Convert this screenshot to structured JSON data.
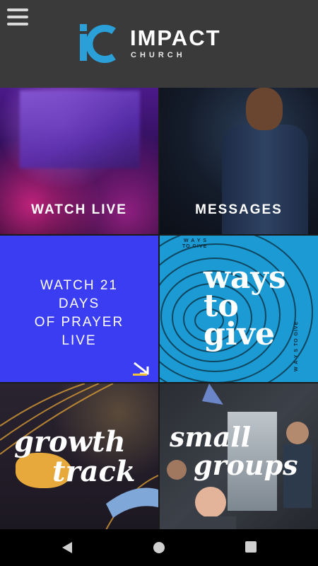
{
  "header": {
    "logo_word": "IMPACT",
    "logo_sub": "CHURCH",
    "menu_icon": "hamburger-menu-icon",
    "accent": "#2a9fd8"
  },
  "tiles": [
    {
      "label": "WATCH LIVE"
    },
    {
      "label": "MESSAGES"
    },
    {
      "label_lines": [
        "WATCH 21",
        "DAYS",
        "OF PRAYER",
        "LIVE"
      ],
      "arrow_icon": "arrow-down-right-icon",
      "arrow_color": "#f2c33a",
      "bg": "#3b3df2"
    },
    {
      "label_lines": [
        "ways",
        "to",
        "give"
      ],
      "mini_top": "W A Y S",
      "mini_top2": "TO   GIVE",
      "mini_side": "W A Y S TO GIVE",
      "bg": "#1b9ad3"
    },
    {
      "label_lines": [
        "growth",
        "track"
      ]
    },
    {
      "label_lines": [
        "small",
        "groups"
      ]
    }
  ],
  "navbar": {
    "back_icon": "back-triangle-icon",
    "home_icon": "home-circle-icon",
    "recents_icon": "recents-square-icon"
  }
}
